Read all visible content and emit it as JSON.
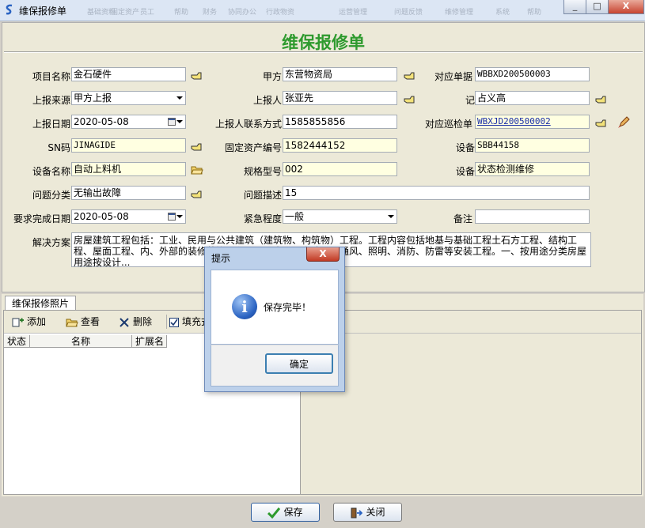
{
  "window": {
    "title": "维保报修单",
    "ghost_menu": [
      "基础资料",
      "固定资产",
      "员工",
      "帮助",
      "财务",
      "协同办公",
      "行政物资",
      "运营管理",
      "问题反馈",
      "维修管理",
      "系统",
      "帮助"
    ],
    "buttons": {
      "minimize": "_",
      "maximize": "□",
      "close": "X"
    }
  },
  "form": {
    "title": "维保报修单",
    "labels": {
      "project_name": "项目名称",
      "party_a": "甲方",
      "related_doc": "对应单据",
      "report_source": "上报来源",
      "reporter": "上报人",
      "recorder": "记录人",
      "report_date": "上报日期",
      "reporter_contact": "上报人联系方式",
      "related_inspection": "对应巡检单",
      "sn": "SN码",
      "asset_no": "固定资产编号",
      "device_no": "设备编号",
      "device_name": "设备名称",
      "spec_model": "规格型号",
      "device_category": "设备类别",
      "issue_category": "问题分类",
      "issue_desc": "问题描述",
      "due_date": "要求完成日期",
      "urgency": "紧急程度",
      "remarks": "备注",
      "solution": "解决方案"
    },
    "values": {
      "project_name": "金石硬件",
      "party_a": "东营物资局",
      "related_doc": "WBBXD200500003",
      "report_source": "甲方上报",
      "reporter": "张亚先",
      "recorder": "占义高",
      "report_date": "2020-05-08",
      "reporter_contact": "1585855856",
      "related_inspection": "WBXJD200500002",
      "sn": "JINAGIDE",
      "asset_no": "1582444152",
      "device_no": "SBB44158",
      "device_name": "自动上料机",
      "spec_model": "002",
      "device_category": "状态检测维修",
      "issue_category": "无输出故障",
      "issue_desc": "15",
      "due_date": "2020-05-08",
      "urgency": "一般",
      "remarks": "",
      "solution": "房屋建筑工程包括：工业、民用与公共建筑（建筑物、构筑物）工程。工程内容包括地基与基础工程土石方工程、结构工程、屋面工程、内、外部的装修装饰工程、上下水、卫生洁具、通风、照明、消防、防雷等安装工程。一、按用途分类房屋用途按设计..."
    }
  },
  "photos": {
    "tab_label": "维保报修照片",
    "toolbar": {
      "add": "添加",
      "view": "查看",
      "delete": "删除",
      "fill": "填充式"
    },
    "fill_checked": true,
    "columns": [
      "状态",
      "名称",
      "扩展名"
    ]
  },
  "footer": {
    "save": "保存",
    "close": "关闭"
  },
  "dialog": {
    "title": "提示",
    "message": "保存完毕！",
    "ok": "确定",
    "close": "X"
  },
  "colors": {
    "title_green": "#2e9a2e",
    "required_yellow": "#ffffe1",
    "link_blue": "#1a2fa8"
  }
}
